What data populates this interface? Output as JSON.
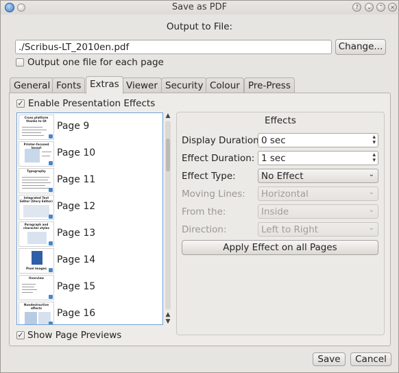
{
  "window": {
    "title": "Save as PDF"
  },
  "output": {
    "heading": "Output to File:",
    "filename": "./Scribus-LT_2010en.pdf",
    "change_label": "Change...",
    "one_file_label": "Output one file for each page"
  },
  "tabs": [
    {
      "label": "General"
    },
    {
      "label": "Fonts"
    },
    {
      "label": "Extras"
    },
    {
      "label": "Viewer"
    },
    {
      "label": "Security"
    },
    {
      "label": "Colour"
    },
    {
      "label": "Pre-Press"
    }
  ],
  "extras": {
    "enable_label": "Enable Presentation Effects",
    "enable_checked": true,
    "pages": [
      {
        "label": "Page 9",
        "thumb_title": "Cross platform thanks to Qt"
      },
      {
        "label": "Page 10",
        "thumb_title": "Printer-focused layout"
      },
      {
        "label": "Page 11",
        "thumb_title": "Typography"
      },
      {
        "label": "Page 12",
        "thumb_title": "Integrated Text Editor (Story Editor)"
      },
      {
        "label": "Page 13",
        "thumb_title": "Paragraph and character styles"
      },
      {
        "label": "Page 14",
        "thumb_title": "Pixel images"
      },
      {
        "label": "Page 15",
        "thumb_title": "Overview"
      },
      {
        "label": "Page 16",
        "thumb_title": "Nondestructive effects"
      }
    ],
    "show_previews_label": "Show Page Previews",
    "show_previews_checked": true
  },
  "effects": {
    "heading": "Effects",
    "display_duration_label": "Display Duration:",
    "display_duration_value": "0 sec",
    "effect_duration_label": "Effect Duration:",
    "effect_duration_value": "1 sec",
    "effect_type_label": "Effect Type:",
    "effect_type_value": "No Effect",
    "moving_lines_label": "Moving Lines:",
    "moving_lines_value": "Horizontal",
    "from_label": "From the:",
    "from_value": "Inside",
    "direction_label": "Direction:",
    "direction_value": "Left to Right",
    "apply_label": "Apply Effect on all Pages"
  },
  "footer": {
    "save_label": "Save",
    "cancel_label": "Cancel"
  }
}
